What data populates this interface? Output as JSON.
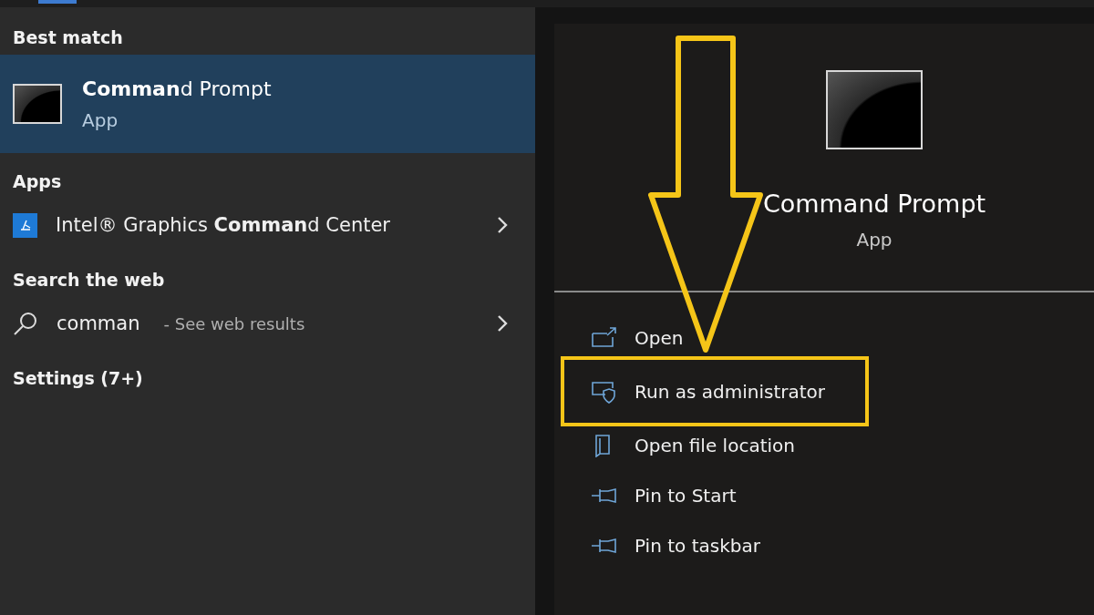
{
  "best_match": {
    "heading": "Best match",
    "title": "**Comman**d Prompt",
    "subtitle": "App",
    "selected": true
  },
  "apps": {
    "heading": "Apps",
    "items": [
      {
        "label": "Intel® Graphics **Comman**d Center"
      }
    ]
  },
  "web": {
    "heading": "Search the web",
    "query": "comman",
    "hint": "- See web results"
  },
  "settings": {
    "heading": "Settings (7+)"
  },
  "detail": {
    "title": "Command Prompt",
    "subtitle": "App"
  },
  "actions": [
    {
      "kind": "open",
      "label": "Open",
      "highlighted": false
    },
    {
      "kind": "admin",
      "label": "Run as administrator",
      "highlighted": true
    },
    {
      "kind": "folder",
      "label": "Open file location",
      "highlighted": false
    },
    {
      "kind": "pin",
      "label": "Pin to Start",
      "highlighted": false
    },
    {
      "kind": "pin",
      "label": "Pin to taskbar",
      "highlighted": false
    }
  ]
}
